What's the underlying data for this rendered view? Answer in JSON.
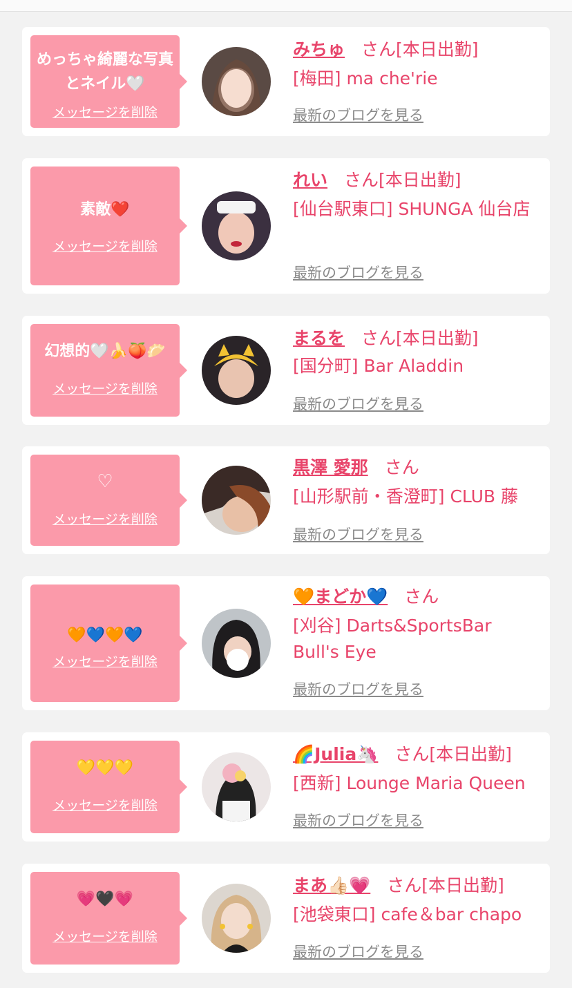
{
  "delete_label": "メッセージを削除",
  "blog_label": "最新のブログを見る",
  "colors": {
    "accent": "#e8446a",
    "bubble": "#fb9aaa",
    "background": "#f2f2f2"
  },
  "cards": [
    {
      "message": "めっちゃ綺麗な写真とネイル🤍",
      "name": "みちゅ",
      "suffix": "さん[本日出勤]",
      "shop": "[梅田] ma che'rie"
    },
    {
      "message": "素敵❤️",
      "name": "れい",
      "suffix": "さん[本日出勤]",
      "shop": "[仙台駅東口] SHUNGA 仙台店"
    },
    {
      "message": "幻想的🤍🍌🍑🥟",
      "name": "まるを",
      "suffix": "さん[本日出勤]",
      "shop": "[国分町] Bar Aladdin"
    },
    {
      "message": "♡",
      "name": "黒澤 愛那",
      "suffix": "さん",
      "shop": "[山形駅前・香澄町] CLUB 藤"
    },
    {
      "message": "🧡💙🧡💙",
      "name": "🧡まどか💙",
      "suffix": "さん",
      "shop": "[刈谷] Darts&SportsBar Bull's Eye"
    },
    {
      "message": "💛💛💛",
      "name": "🌈Julia🦄",
      "suffix": "さん[本日出勤]",
      "shop": "[西新] Lounge Maria Queen"
    },
    {
      "message": "💗🖤💗",
      "name": "まあ👍🏻💗",
      "suffix": "さん[本日出勤]",
      "shop": "[池袋東口] cafe＆bar chapo"
    }
  ]
}
